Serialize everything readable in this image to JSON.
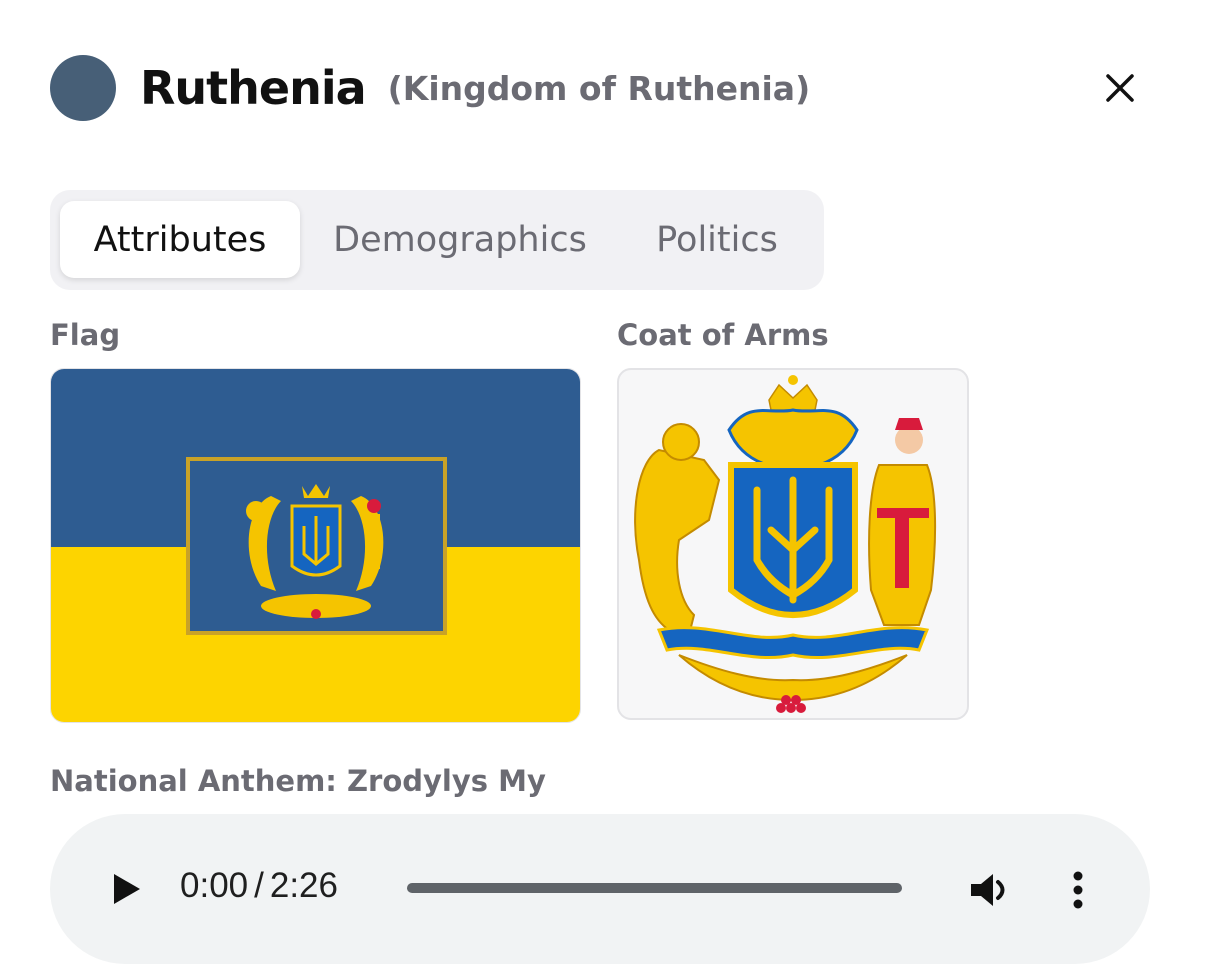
{
  "header": {
    "title": "Ruthenia",
    "subtitle": "(Kingdom of Ruthenia)",
    "avatar_color": "#475f77",
    "close_icon": "close-icon"
  },
  "tabs": [
    {
      "label": "Attributes",
      "active": true
    },
    {
      "label": "Demographics",
      "active": false
    },
    {
      "label": "Politics",
      "active": false
    }
  ],
  "attributes": {
    "flag_label": "Flag",
    "coat_of_arms_label": "Coat of Arms",
    "anthem_label": "National Anthem: Zrodylys My"
  },
  "flag": {
    "top_color": "#2e5c91",
    "bottom_color": "#fdd400",
    "emblem_frame_color": "#c9a227"
  },
  "coat_of_arms": {
    "shield_color": "#1565c0",
    "gold_color": "#f5c400",
    "red_color": "#d81b3c"
  },
  "audio_player": {
    "current_time": "0:00",
    "separator": "/",
    "duration": "2:26",
    "progress_fraction": 0,
    "play_icon": "play-icon",
    "volume_icon": "volume-icon",
    "menu_icon": "more-vertical-icon"
  }
}
